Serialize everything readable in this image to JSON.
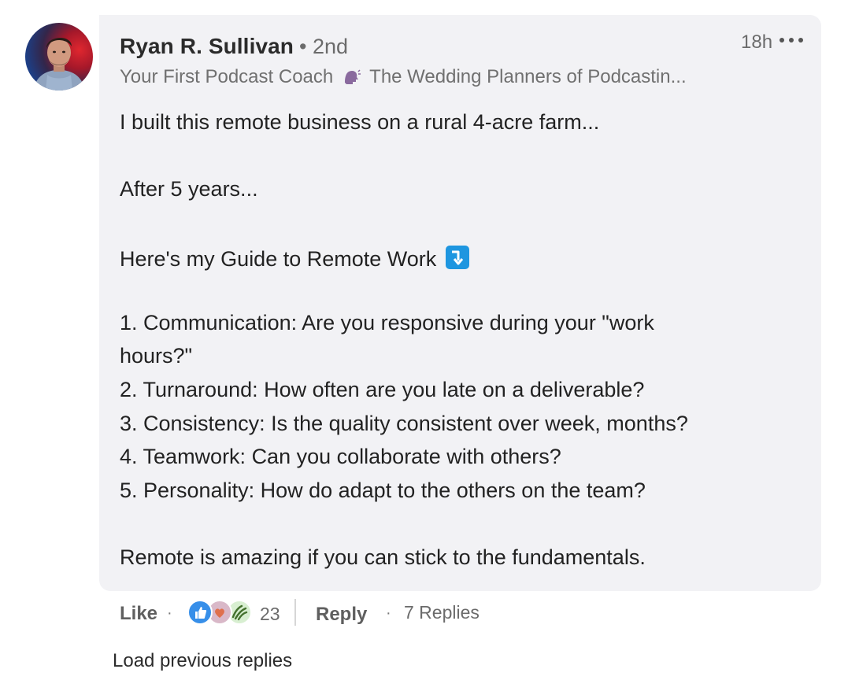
{
  "comment": {
    "author": "Ryan R. Sullivan",
    "degree": "• 2nd",
    "headline_part1": "Your First Podcast Coach",
    "headline_part2": "The Wedding Planners of Podcastin...",
    "time": "18h",
    "lines": [
      "I built this remote business on a rural 4-acre farm...",
      "After 5 years...",
      "Here's my Guide to Remote Work",
      "1. Communication: Are you responsive during your \"work",
      "hours?\"",
      "2. Turnaround: How often are you late on a deliverable?",
      "3. Consistency: Is the quality consistent over week, months?",
      "4. Teamwork: Can you collaborate with others?",
      "5. Personality: How do adapt to the others on the team?",
      "Remote is amazing if you can stick to the fundamentals."
    ]
  },
  "actions": {
    "like": "Like",
    "separator": "·",
    "reaction_count": "23",
    "reply": "Reply",
    "replies": "7 Replies",
    "load_previous": "Load previous replies"
  },
  "icons": {
    "headline_icon": "speaking-head-icon",
    "guide_icon": "arrow-down-emoji-icon",
    "more": "ellipsis-icon",
    "reactions": [
      "like-reaction-icon",
      "love-reaction-icon",
      "celebrate-reaction-icon"
    ]
  },
  "colors": {
    "bubble": "#f2f2f5",
    "emoji_blue": "#1e96e0",
    "like_blue": "#378fe9",
    "celebrate_green": "#44712e",
    "love_pink": "#df704d"
  }
}
